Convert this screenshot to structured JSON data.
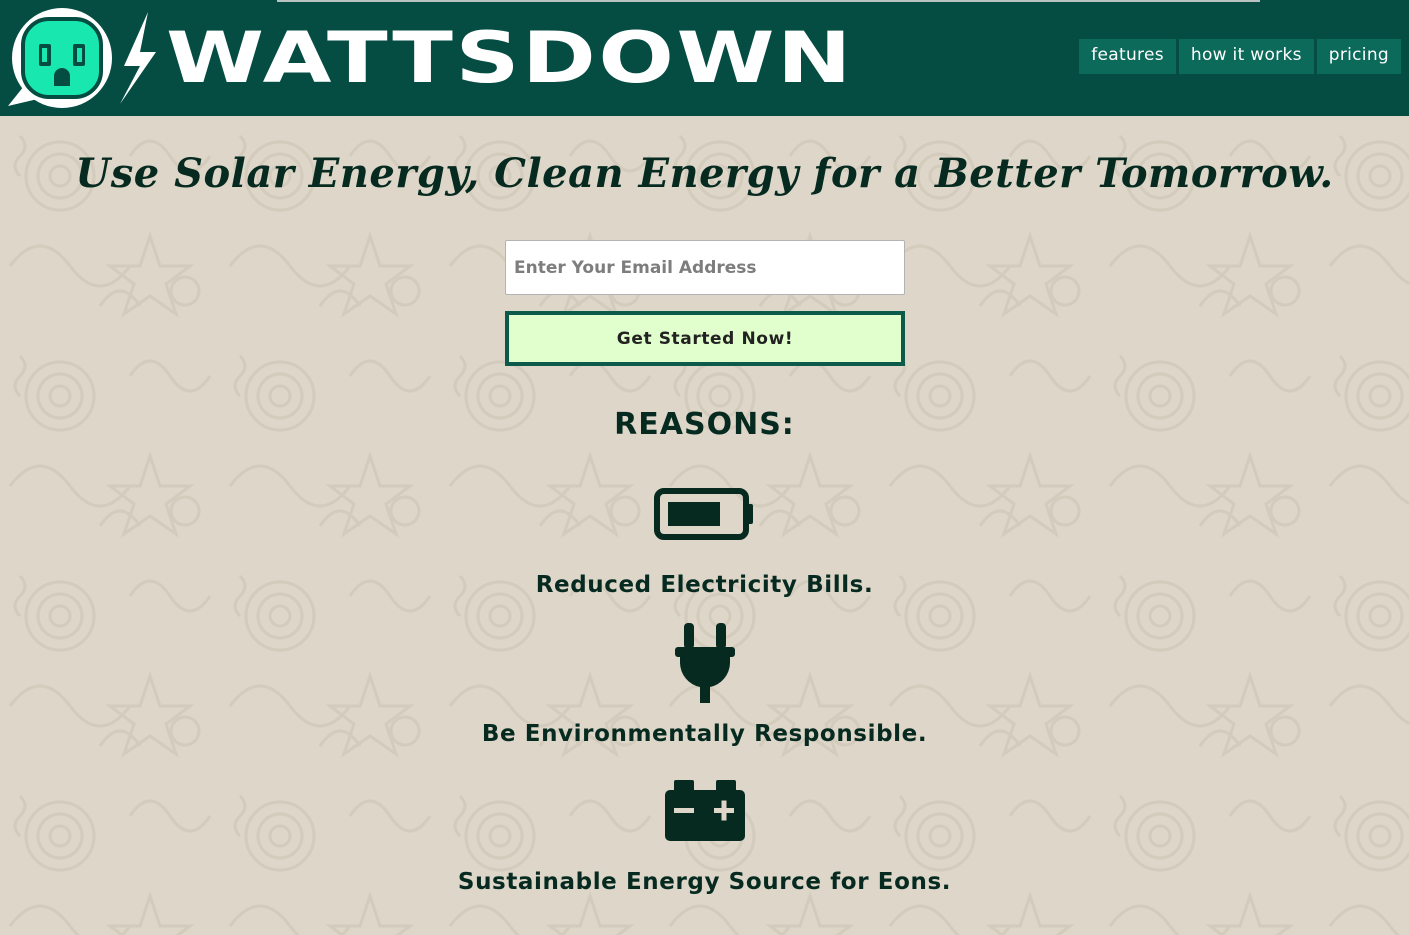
{
  "header": {
    "brand": "WATTSDOWN",
    "nav": [
      {
        "label": "features"
      },
      {
        "label": "how it works"
      },
      {
        "label": "pricing"
      }
    ]
  },
  "hero": {
    "tagline": "Use Solar Energy, Clean Energy for a Better Tomorrow.",
    "email_placeholder": "Enter Your Email Address",
    "cta_label": "Get Started Now!"
  },
  "reasons": {
    "heading": "REASONS:",
    "items": [
      {
        "icon": "battery-icon",
        "text": "Reduced Electricity Bills."
      },
      {
        "icon": "plug-icon",
        "text": "Be Environmentally Responsible."
      },
      {
        "icon": "car-battery-icon",
        "text": "Sustainable Energy Source for Eons."
      }
    ]
  },
  "colors": {
    "header_bg": "#054d43",
    "nav_bg": "#0c6a5a",
    "page_bg": "#ddd6c9",
    "text_dark": "#062a20",
    "logo_face": "#18e8b0",
    "cta_bg": "#e0ffcc",
    "cta_border": "#0b5a4a"
  }
}
